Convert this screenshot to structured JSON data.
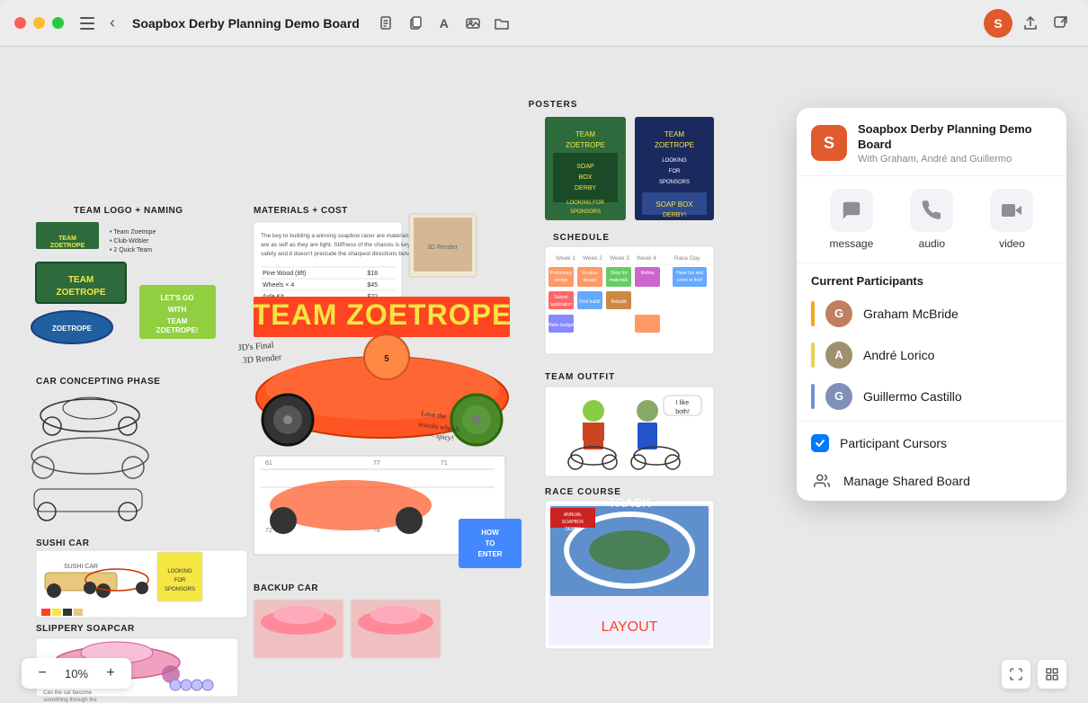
{
  "window": {
    "title": "Soapbox Derby Planning Demo Board"
  },
  "titlebar": {
    "title": "Soapbox Derby Planning Demo Board",
    "back_label": "‹",
    "nav_icon": "⊞",
    "toolbar_icons": [
      "📋",
      "⧉",
      "A",
      "🖼",
      "📁"
    ]
  },
  "zoom": {
    "level": "10%",
    "minus_label": "−",
    "plus_label": "+"
  },
  "collab_panel": {
    "board_name": "Soapbox Derby Planning Demo Board",
    "board_subtitle": "With Graham, André and Guillermo",
    "logo_letter": "S",
    "actions": [
      {
        "id": "message",
        "icon": "💬",
        "label": "message"
      },
      {
        "id": "audio",
        "icon": "📞",
        "label": "audio"
      },
      {
        "id": "video",
        "icon": "🎥",
        "label": "video"
      }
    ],
    "section_title": "Current Participants",
    "participants": [
      {
        "name": "Graham McBride",
        "color": "#f5a623",
        "initial": "G",
        "bg": "#c0855d"
      },
      {
        "name": "André Lorico",
        "color": "#f5e642",
        "initial": "A",
        "bg": "#8a7a5e"
      },
      {
        "name": "Guillermo Castillo",
        "color": "#7b9de0",
        "initial": "G",
        "bg": "#7a8fbb"
      }
    ],
    "options": [
      {
        "id": "participant-cursors",
        "label": "Participant Cursors",
        "icon": "checkbox"
      },
      {
        "id": "manage-shared-board",
        "label": "Manage Shared Board",
        "icon": "people"
      }
    ]
  },
  "board_sections": [
    {
      "id": "posters",
      "label": "POSTERS"
    },
    {
      "id": "materials-cost",
      "label": "MATERIALS + COST"
    },
    {
      "id": "team-logo",
      "label": "TEAM LOGO + NAMING"
    },
    {
      "id": "car-concepting",
      "label": "CAR CONCEPTING PHASE"
    },
    {
      "id": "sushi-car",
      "label": "SUSHI CAR"
    },
    {
      "id": "slippery-soapcar",
      "label": "SLIPPERY SOAPCAR"
    },
    {
      "id": "backup-car",
      "label": "BACKUP CAR"
    },
    {
      "id": "schedule",
      "label": "SCHEDULE"
    },
    {
      "id": "team-outfit",
      "label": "TEAM OUTFIT"
    },
    {
      "id": "race-course",
      "label": "RACE COURSE"
    }
  ]
}
